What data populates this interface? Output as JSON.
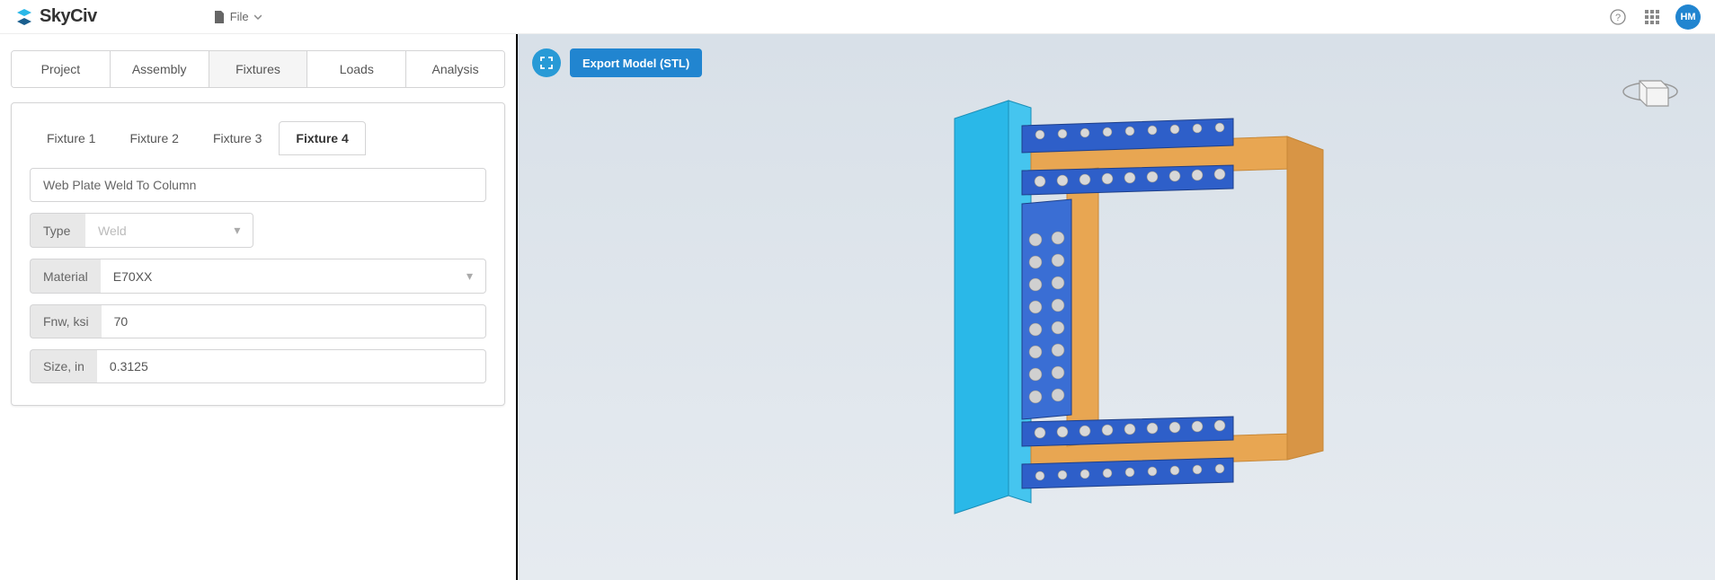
{
  "header": {
    "brand": "SkyCiv",
    "file_label": "File",
    "avatar_initials": "HM"
  },
  "main_tabs": [
    "Project",
    "Assembly",
    "Fixtures",
    "Loads",
    "Analysis"
  ],
  "main_tabs_active_index": 2,
  "fixture_tabs": [
    "Fixture 1",
    "Fixture 2",
    "Fixture 3",
    "Fixture 4"
  ],
  "fixture_tabs_active_index": 3,
  "fixture_form": {
    "title": "Web Plate Weld To Column",
    "type_label": "Type",
    "type_value": "Weld",
    "material_label": "Material",
    "material_value": "E70XX",
    "fnw_label": "Fnw, ksi",
    "fnw_value": "70",
    "size_label": "Size, in",
    "size_value": "0.3125"
  },
  "viewport": {
    "export_label": "Export Model (STL)"
  }
}
